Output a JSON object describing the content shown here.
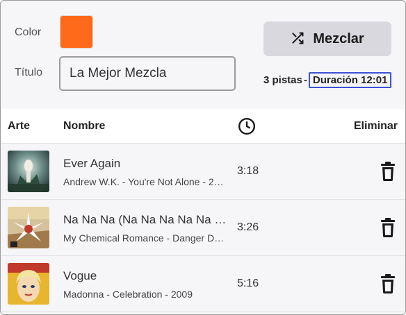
{
  "form": {
    "color_label": "Color",
    "color_value": "#ff6a1a",
    "title_label": "Título",
    "title_value": "La Mejor Mezcla"
  },
  "shuffle_button": {
    "label": "Mezclar",
    "icon": "shuffle-icon"
  },
  "stats": {
    "tracks": "3 pistas",
    "separator": "-",
    "duration": "Duración 12:01"
  },
  "table": {
    "headers": {
      "art": "Arte",
      "name": "Nombre",
      "duration_icon": "clock-icon",
      "delete": "Eliminar"
    },
    "rows": [
      {
        "title": "Ever Again",
        "subtitle": "Andrew W.K. - You're Not Alone - 2…",
        "duration": "3:18",
        "art_icon": "album-art-you-re-not-alone"
      },
      {
        "title": "Na Na Na (Na Na Na Na Na Na …",
        "subtitle": "My Chemical Romance - Danger Da…",
        "duration": "3:26",
        "art_icon": "album-art-danger-days"
      },
      {
        "title": "Vogue",
        "subtitle": "Madonna - Celebration - 2009",
        "duration": "5:16",
        "art_icon": "album-art-celebration"
      }
    ]
  },
  "colors": {
    "accent_focus": "#3d4fd6",
    "button_bg": "#d9d8df",
    "swatch": "#ff6a1a"
  }
}
